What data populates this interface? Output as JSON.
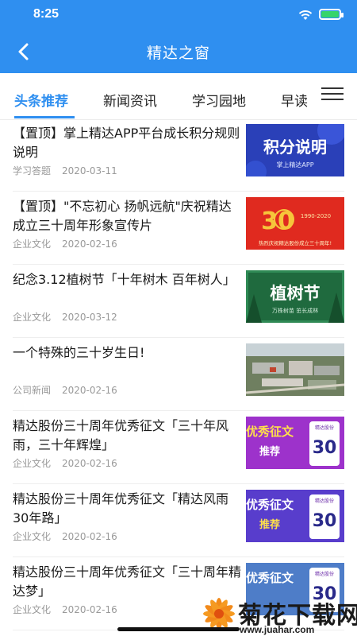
{
  "status_bar": {
    "time": "8:25"
  },
  "header": {
    "title": "精达之窗"
  },
  "tabs": [
    {
      "label": "头条推荐",
      "active": true
    },
    {
      "label": "新闻资讯",
      "active": false
    },
    {
      "label": "学习园地",
      "active": false
    },
    {
      "label": "早读",
      "active": false
    }
  ],
  "articles": [
    {
      "title": "【置顶】掌上精达APP平台成长积分规则说明",
      "category": "学习答题",
      "date": "2020-03-11",
      "thumb_text": "积分说明",
      "thumb_sub": "掌上精达APP"
    },
    {
      "title": "【置顶】\"不忘初心  扬帆远航\"庆祝精达成立三十周年形象宣传片",
      "category": "企业文化",
      "date": "2020-02-16",
      "thumb_text": "热烈庆祝精达股份成立三十周年!",
      "thumb_sub": "1990-2020"
    },
    {
      "title": "纪念3.12植树节「十年树木  百年树人」",
      "category": "企业文化",
      "date": "2020-03-12",
      "thumb_text": "植树节",
      "thumb_sub": "万株树苗  茁长成林"
    },
    {
      "title": "一个特殊的三十岁生日!",
      "category": "公司新闻",
      "date": "2020-02-16"
    },
    {
      "title": "精达股份三十周年优秀征文「三十年风雨，三十年辉煌」",
      "category": "企业文化",
      "date": "2020-02-16",
      "thumb_text": "优秀征文",
      "thumb_badge": "推荐",
      "thumb_num": "30",
      "thumb_sub": "精达股份"
    },
    {
      "title": "精达股份三十周年优秀征文「精达风雨30年路」",
      "category": "企业文化",
      "date": "2020-02-16",
      "thumb_text": "优秀征文",
      "thumb_badge": "推荐",
      "thumb_num": "30",
      "thumb_sub": "精达股份"
    },
    {
      "title": "精达股份三十周年优秀征文「三十周年精达梦」",
      "category": "企业文化",
      "date": "2020-02-16",
      "thumb_text": "优秀征文",
      "thumb_num": "30",
      "thumb_sub": "精达股份"
    }
  ],
  "watermark": {
    "text": "菊花下载网",
    "url": "www.juahar.com"
  },
  "colors": {
    "brand_blue": "#2f8ff0",
    "text": "#1a1a1a",
    "meta": "#999999"
  }
}
